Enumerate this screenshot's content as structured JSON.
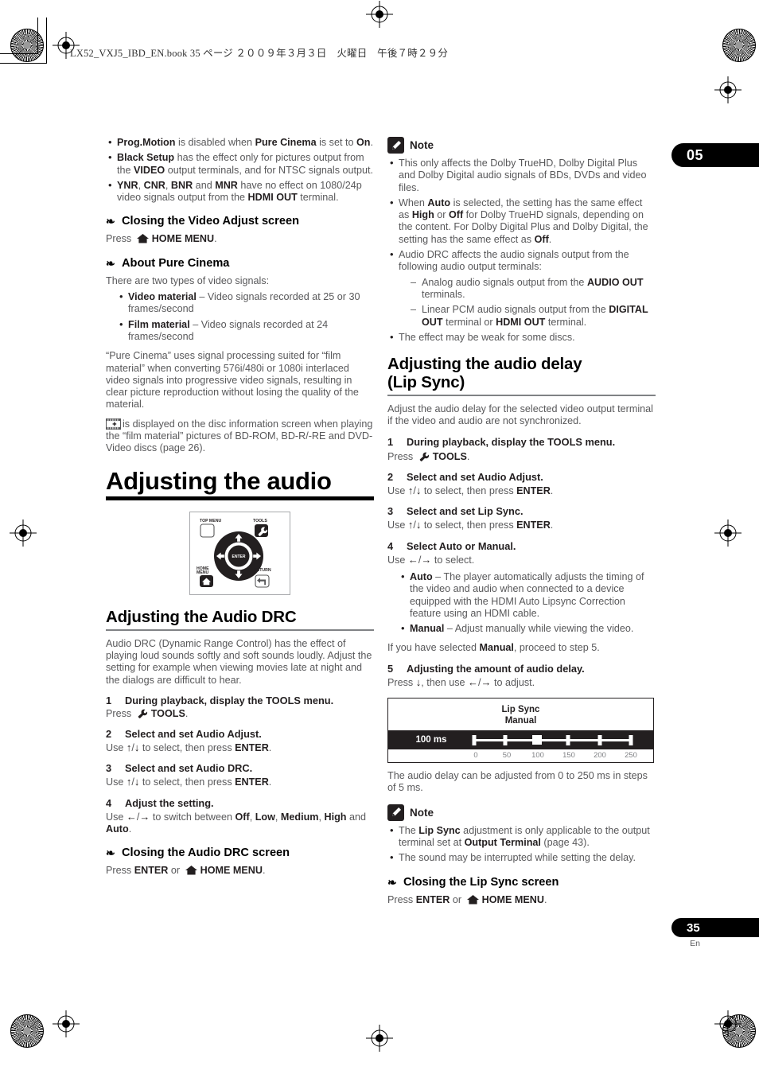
{
  "header": {
    "text": "LX52_VXJ5_IBD_EN.book    35 ページ    ２００９年３月３日　火曜日　午後７時２９分"
  },
  "chapter_tab": {
    "number": "05"
  },
  "folio": {
    "page": "35",
    "language": "En"
  },
  "left_column": {
    "intro_bullets": [
      "<b>Prog.Motion</b> is disabled when <b>Pure Cinema</b> is set to <b>On</b>.",
      "<b>Black Setup</b> has the effect only for pictures output from the <b>VIDEO</b> output terminals, and for NTSC signals output.",
      "<b>YNR</b>, <b>CNR</b>, <b>BNR</b> and <b>MNR</b> have no effect on 1080/24p video signals output from the <b>HDMI OUT</b> terminal."
    ],
    "closing_video_adjust": {
      "title": "Closing the Video Adjust screen",
      "press_prefix": "Press",
      "press_target": "HOME MENU",
      "press_suffix": "."
    },
    "about_pure_cinema": {
      "title": "About Pure Cinema",
      "lead": "There are two types of video signals:",
      "bullets": [
        "<b>Video material</b> – Video signals recorded at 25 or 30 frames/second",
        "<b>Film material</b> – Video signals recorded at 24 frames/second"
      ],
      "paragraph": "“Pure Cinema” uses signal processing suited for “film material” when converting 576i/480i or 1080i interlaced video signals into progressive video signals, resulting in clear picture reproduction without losing the quality of the material.",
      "icon_note": "is displayed on the disc information screen when playing the “film material” pictures of BD-ROM, BD-R/-RE and DVD-Video discs (page 26)."
    },
    "chapter_heading": "Adjusting the audio",
    "remote_figure": {
      "top_menu_label": "TOP MENU",
      "tools_label": "TOOLS",
      "home_menu_label": "HOME MENU",
      "return_label": "RETURN",
      "enter_label": "ENTER"
    },
    "audio_drc": {
      "title": "Adjusting the Audio DRC",
      "intro": "Audio DRC (Dynamic Range Control) has the effect of playing loud sounds softly and soft sounds loudly. Adjust the setting for example when viewing movies late at night and the dialogs are difficult to hear.",
      "steps": [
        {
          "num": "1",
          "head": "During playback, display the TOOLS menu.",
          "body_prefix": "Press",
          "body_target": "TOOLS",
          "body_suffix": "."
        },
        {
          "num": "2",
          "head": "Select and set Audio Adjust.",
          "body_html": "Use <b class=\"arrow\">↑</b>/<b class=\"arrow\">↓</b> to select, then press <b>ENTER</b>."
        },
        {
          "num": "3",
          "head": "Select and set Audio DRC.",
          "body_html": "Use <b class=\"arrow\">↑</b>/<b class=\"arrow\">↓</b> to select, then press <b>ENTER</b>."
        },
        {
          "num": "4",
          "head": "Adjust the setting.",
          "body_html": "Use <b class=\"arrow\">←</b>/<b class=\"arrow\">→</b> to switch between <b>Off</b>, <b>Low</b>, <b>Medium</b>, <b>High</b> and <b>Auto</b>."
        }
      ],
      "closing": {
        "title": "Closing the Audio DRC screen",
        "press_prefix": "Press",
        "press_enter": "ENTER",
        "press_or": "or",
        "press_target": "HOME MENU",
        "press_suffix": "."
      }
    }
  },
  "right_column": {
    "note_top": {
      "label": "Note",
      "bullets": [
        "This only affects the Dolby TrueHD, Dolby Digital Plus and Dolby Digital audio signals of BDs, DVDs and video files.",
        "When <b>Auto</b> is selected, the setting has the same effect as <b>High</b> or <b>Off</b> for Dolby TrueHD signals, depending on the content. For Dolby Digital Plus and Dolby Digital, the setting has the same effect as <b>Off</b>.",
        "Audio DRC affects the audio signals output from the following audio output terminals:",
        "The effect may be weak for some discs."
      ],
      "sub_bullets": [
        "Analog audio signals output from the <b>AUDIO OUT</b> terminals.",
        "Linear PCM audio signals output from the <b>DIGITAL OUT</b> terminal or <b>HDMI OUT</b> terminal."
      ]
    },
    "lip_sync": {
      "title_line1": "Adjusting the audio delay",
      "title_line2": "(Lip Sync)",
      "intro": "Adjust the audio delay for the selected video output terminal if the video and audio are not synchronized.",
      "steps": [
        {
          "num": "1",
          "head": "During playback, display the TOOLS menu.",
          "body_prefix": "Press",
          "body_target": "TOOLS",
          "body_suffix": "."
        },
        {
          "num": "2",
          "head": "Select and set Audio Adjust.",
          "body_html": "Use <b class=\"arrow\">↑</b>/<b class=\"arrow\">↓</b> to select, then press <b>ENTER</b>."
        },
        {
          "num": "3",
          "head": "Select and set Lip Sync.",
          "body_html": "Use <b class=\"arrow\">↑</b>/<b class=\"arrow\">↓</b> to select, then press <b>ENTER</b>."
        },
        {
          "num": "4",
          "head": "Select Auto or Manual.",
          "body_html": "Use <b class=\"arrow\">←</b>/<b class=\"arrow\">→</b> to select."
        }
      ],
      "mode_bullets": [
        "<b>Auto</b> – The player automatically adjusts the timing of the video and audio when connected to a device equipped with the HDMI Auto Lipsync Correction feature using an HDMI cable.",
        "<b>Manual</b> – Adjust manually while viewing the video."
      ],
      "manual_note": "If you have selected <b>Manual</b>, proceed to step 5.",
      "step5": {
        "num": "5",
        "head": "Adjusting the amount of audio delay.",
        "body_html": "Press <b class=\"arrow\">↓</b>, then use <b class=\"arrow\">←</b>/<b class=\"arrow\">→</b> to adjust."
      },
      "osd": {
        "title": "Lip Sync",
        "mode": "Manual",
        "value": "100 ms",
        "scale": [
          "0",
          "50",
          "100",
          "150",
          "200",
          "250"
        ],
        "knob_at": "100"
      },
      "range_note": "The audio delay can be adjusted from 0 to 250 ms in steps of 5 ms.",
      "note_bottom": {
        "label": "Note",
        "bullets": [
          "The <b>Lip Sync</b> adjustment is only applicable to the output terminal set at <b>Output Terminal</b> (page 43).",
          "The sound may be interrupted while setting the delay."
        ]
      },
      "closing": {
        "title": "Closing the Lip Sync screen",
        "press_prefix": "Press",
        "press_enter": "ENTER",
        "press_or": "or",
        "press_target": "HOME MENU",
        "press_suffix": "."
      }
    }
  },
  "colors": {
    "body_text": "#58585a",
    "bold_text": "#231f20",
    "rule_gray": "#808285",
    "black": "#000000"
  }
}
